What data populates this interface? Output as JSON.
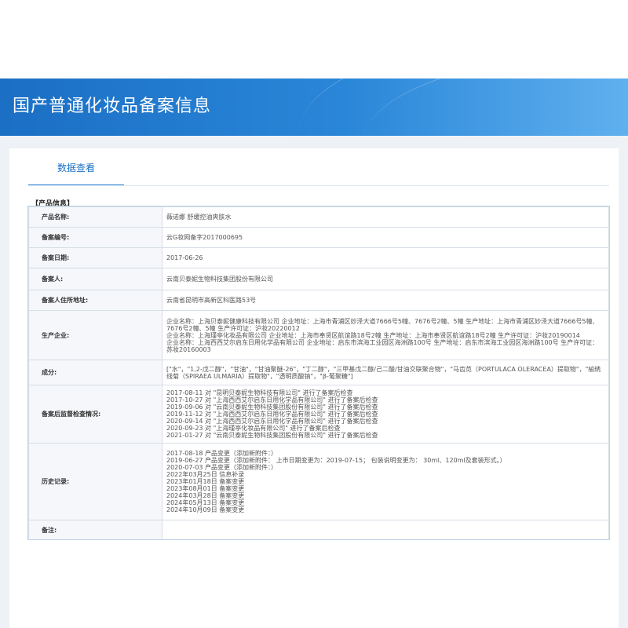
{
  "header": {
    "title": "国产普通化妆品备案信息"
  },
  "tab": {
    "label": "数据查看"
  },
  "section": {
    "label": "【产品信息】"
  },
  "fields": {
    "product_name": {
      "label": "产品名称:",
      "value": "薇诺娜 舒缓控油爽肤水"
    },
    "record_no": {
      "label": "备案编号:",
      "value": "云G妆网备字2017000695"
    },
    "record_date": {
      "label": "备案日期:",
      "value": "2017-06-26"
    },
    "registrant": {
      "label": "备案人:",
      "value": "云南贝泰妮生物科技集团股份有限公司"
    },
    "registrant_address": {
      "label": "备案人住所地址:",
      "value": "云南省昆明市高新区科医路53号"
    },
    "manufacturer": {
      "label": "生产企业:",
      "value": "企业名称：上海贝泰妮健康科技有限公司 企业地址：上海市青浦区妙泽大道7666号5幢、7676号2幢、5幢 生产地址：上海市青浦区妙泽大道7666号5幢、7676号2幢、5幢 生产许可证：沪妆20220012\n企业名称：上海瑾亭化妆品有限公司 企业地址：上海市奉贤区航谊路18号2幢 生产地址：上海市奉贤区航谊路18号2幢 生产许可证：沪妆20190014\n企业名称：上海西西艾尔启东日用化学品有限公司 企业地址：启东市滨海工业园区海洲路100号 生产地址：启东市滨海工业园区海洲路100号 生产许可证：苏妆20160003"
    },
    "ingredients": {
      "label": "成分:",
      "value": "[\"水\"，\"1,2-戊二醇\"，\"甘油\"，\"甘油聚醚-26\"，\"丁二醇\"，\"三甲基戊二醇/己二酸/甘油交联聚合物\"，\"马齿苋（PORTULACA OLERACEA）提取物\"，\"榆绣线菊（SPIRAEA ULMARIA）提取物\"，\"透明质酸钠\"，\"β-葡聚糖\"]"
    },
    "inspection": {
      "label": "备案后监督检查情况:",
      "value": "2017-08-11 对 \"昆明贝泰妮生物科技有限公司\" 进行了备案后检查\n2017-10-27 对 \"上海西西艾尔启东日用化学品有限公司\" 进行了备案后检查\n2019-09-06 对 \"云南贝泰妮生物科技集团股份有限公司\" 进行了备案后检查\n2019-11-12 对 \"上海西西艾尔启东日用化学品有限公司\" 进行了备案后检查\n2020-09-14 对 \"上海西西艾尔启东日用化学品有限公司\" 进行了备案后检查\n2020-09-23 对 \"上海瑾亭化妆品有限公司\" 进行了备案后检查\n2021-01-27 对 \"云南贝泰妮生物科技集团股份有限公司\" 进行了备案后检查"
    },
    "history": {
      "label": "历史记录:",
      "value": "2017-08-18 产品变更（添加新附件：）\n2019-06-27 产品变更（添加新附件：   上市日期变更为：2019-07-15；  包装说明变更为： 30ml、120ml及套装形式。）\n2020-07-03 产品变更（添加新附件：）\n2022年03月25日 信息补录\n2023年01月18日 备案变更\n2023年08月01日 备案变更\n2024年03月28日 备案变更\n2024年05月13日 备案变更\n2024年10月09日 备案变更"
    },
    "remarks": {
      "label": "备注:",
      "value": ""
    }
  }
}
